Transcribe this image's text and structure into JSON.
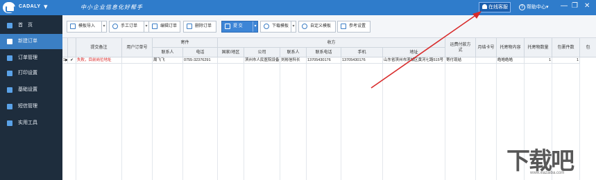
{
  "titlebar": {
    "app_name": "CADALY",
    "tagline": "中小企业信息化好帮手",
    "online_service": "在线客服",
    "help_center": "帮助中心",
    "chevron_glyph": "▾",
    "minimize_glyph": "—",
    "restore_glyph": "❐",
    "close_glyph": "✕"
  },
  "sidebar": {
    "items": [
      {
        "label": "首　页",
        "icon": "home-icon"
      },
      {
        "label": "新建订单",
        "icon": "new-order-icon"
      },
      {
        "label": "订单管理",
        "icon": "order-manage-icon"
      },
      {
        "label": "打印设置",
        "icon": "printer-icon"
      },
      {
        "label": "基础设置",
        "icon": "settings-icon"
      },
      {
        "label": "短信管理",
        "icon": "phone-icon"
      },
      {
        "label": "实用工具",
        "icon": "toolbox-icon"
      }
    ]
  },
  "toolbar": {
    "import": "模板导入",
    "manual": "手工订单",
    "edit": "编辑订单",
    "delete": "删除订单",
    "submit": "提 交",
    "download": "下载模板",
    "custom": "自定义模板",
    "tip": "参考设置",
    "dropdown_glyph": "▾"
  },
  "grid": {
    "headers": {
      "submit_note": "提交备注",
      "user_order_no": "用户订单号",
      "sender_group": "寄件",
      "sender_contact": "联系人",
      "sender_phone": "电话",
      "receiver_group": "收方",
      "country": "国家/地区",
      "company": "公司",
      "receiver_contact": "联系人",
      "contact_phone": "联系电话",
      "mobile": "手机",
      "address": "地址",
      "payment": "运费付款方式",
      "monthly_card": "月结卡号",
      "content": "托寄物内容",
      "quantity": "托寄物数量",
      "packages": "包裹件数",
      "extra": "包"
    },
    "row": {
      "marker": "1▶",
      "checked": "✔",
      "submit_note": "失败，目前岗位地址",
      "sender_contact": "周飞飞",
      "sender_phone": "0755-32376291",
      "company": "滨州市人民医院设备",
      "receiver_contact": "刘彬信科长",
      "contact_phone": "13705430176",
      "mobile": "13705430176",
      "address": "山东省滨州市滨城区黄河七路515号",
      "payment": "寄付现结",
      "content": "皓皓皓皓",
      "quantity": "1",
      "packages": "1"
    }
  },
  "watermark": {
    "text": "下载吧",
    "url": "www.xiazaiba.com"
  },
  "colors": {
    "titlebar": "#2f7ccb",
    "sidebar": "#1e2d3d",
    "sidebar_active": "#3b7fc4",
    "error_text": "#d62020",
    "annotation_arrow": "#d82a2a"
  }
}
